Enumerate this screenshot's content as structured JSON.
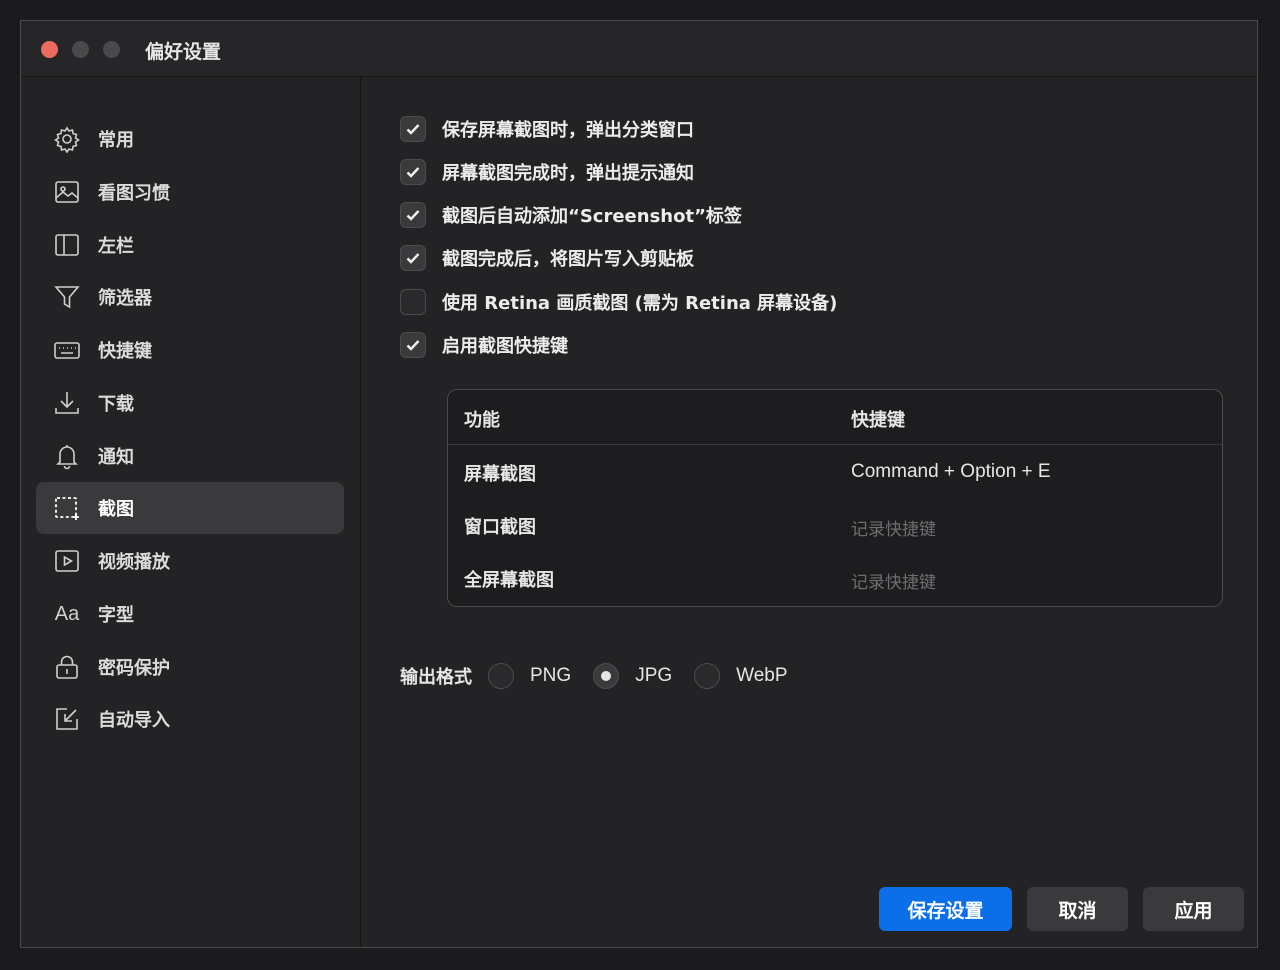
{
  "window": {
    "title": "偏好设置"
  },
  "sidebar": {
    "items": [
      {
        "label": "常用",
        "icon": "gear-icon"
      },
      {
        "label": "看图习惯",
        "icon": "image-icon"
      },
      {
        "label": "左栏",
        "icon": "sidebar-icon"
      },
      {
        "label": "筛选器",
        "icon": "filter-icon"
      },
      {
        "label": "快捷键",
        "icon": "keyboard-icon"
      },
      {
        "label": "下载",
        "icon": "download-icon"
      },
      {
        "label": "通知",
        "icon": "bell-icon"
      },
      {
        "label": "截图",
        "icon": "screenshot-icon",
        "active": true
      },
      {
        "label": "视频播放",
        "icon": "play-icon"
      },
      {
        "label": "字型",
        "icon": "font-icon",
        "icon_text": "Aa"
      },
      {
        "label": "密码保护",
        "icon": "lock-icon"
      },
      {
        "label": "自动导入",
        "icon": "import-icon"
      }
    ]
  },
  "options": [
    {
      "label": "保存屏幕截图时，弹出分类窗口",
      "checked": true
    },
    {
      "label": "屏幕截图完成时，弹出提示通知",
      "checked": true
    },
    {
      "label": "截图后自动添加“Screenshot”标签",
      "checked": true
    },
    {
      "label": "截图完成后，将图片写入剪贴板",
      "checked": true
    },
    {
      "label": "使用 Retina 画质截图 (需为 Retina 屏幕设备)",
      "checked": false
    },
    {
      "label": "启用截图快捷键",
      "checked": true
    }
  ],
  "shortcuts": {
    "headers": {
      "function": "功能",
      "shortcut": "快捷键"
    },
    "rows": [
      {
        "function": "屏幕截图",
        "shortcut": "Command + Option + E",
        "recorded": true
      },
      {
        "function": "窗口截图",
        "shortcut": "记录快捷键",
        "recorded": false
      },
      {
        "function": "全屏幕截图",
        "shortcut": "记录快捷键",
        "recorded": false
      }
    ]
  },
  "output_format": {
    "label": "输出格式",
    "options": [
      "PNG",
      "JPG",
      "WebP"
    ],
    "selected": "JPG"
  },
  "buttons": {
    "save": "保存设置",
    "cancel": "取消",
    "apply": "应用"
  },
  "colors": {
    "accent": "#0a6fe8",
    "close": "#ed6a5e"
  }
}
